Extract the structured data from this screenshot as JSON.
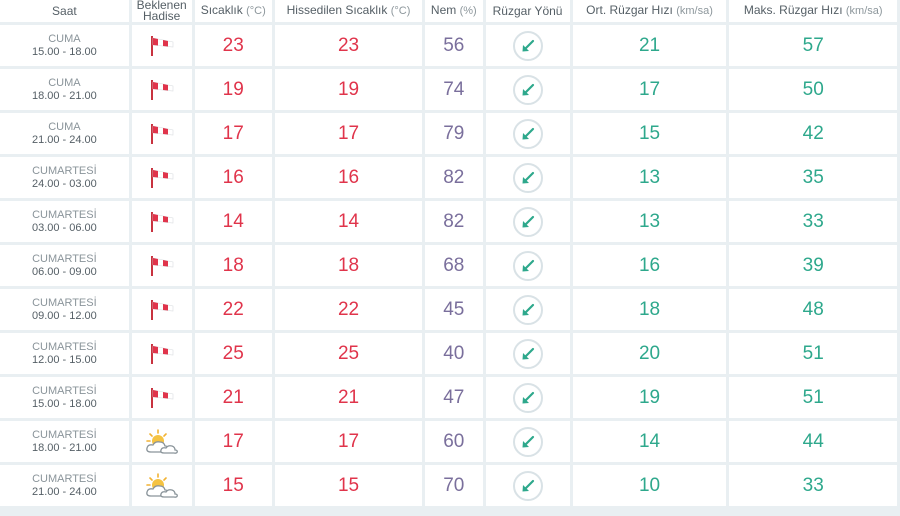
{
  "headers": {
    "saat": "Saat",
    "hadise_line1": "Beklenen",
    "hadise_line2": "Hadise",
    "sicaklik": "Sıcaklık",
    "sicaklik_unit": "(°C)",
    "hissedilen": "Hissedilen Sıcaklık",
    "hissedilen_unit": "(°C)",
    "nem": "Nem",
    "nem_unit": "(%)",
    "ruzgar_yonu": "Rüzgar Yönü",
    "ort_ruzgar": "Ort. Rüzgar Hızı",
    "ort_ruzgar_unit": "(km/sa)",
    "maks_ruzgar": "Maks. Rüzgar Hızı",
    "maks_ruzgar_unit": "(km/sa)"
  },
  "colors": {
    "temperature": "#e0344b",
    "humidity": "#7a6f9c",
    "wind": "#2ea88c",
    "background": "#e9eff2"
  },
  "rows": [
    {
      "day": "CUMA",
      "time": "15.00 - 18.00",
      "icon": "windy-flag-icon",
      "temp": "23",
      "feels": "23",
      "humidity": "56",
      "wind_dir_icon": "arrow-southwest-icon",
      "avg_wind": "21",
      "max_wind": "57"
    },
    {
      "day": "CUMA",
      "time": "18.00 - 21.00",
      "icon": "windy-flag-icon",
      "temp": "19",
      "feels": "19",
      "humidity": "74",
      "wind_dir_icon": "arrow-southwest-icon",
      "avg_wind": "17",
      "max_wind": "50"
    },
    {
      "day": "CUMA",
      "time": "21.00 - 24.00",
      "icon": "windy-flag-icon",
      "temp": "17",
      "feels": "17",
      "humidity": "79",
      "wind_dir_icon": "arrow-southwest-icon",
      "avg_wind": "15",
      "max_wind": "42"
    },
    {
      "day": "CUMARTESİ",
      "time": "24.00 - 03.00",
      "icon": "windy-flag-icon",
      "temp": "16",
      "feels": "16",
      "humidity": "82",
      "wind_dir_icon": "arrow-southwest-icon",
      "avg_wind": "13",
      "max_wind": "35"
    },
    {
      "day": "CUMARTESİ",
      "time": "03.00 - 06.00",
      "icon": "windy-flag-icon",
      "temp": "14",
      "feels": "14",
      "humidity": "82",
      "wind_dir_icon": "arrow-southwest-icon",
      "avg_wind": "13",
      "max_wind": "33"
    },
    {
      "day": "CUMARTESİ",
      "time": "06.00 - 09.00",
      "icon": "windy-flag-icon",
      "temp": "18",
      "feels": "18",
      "humidity": "68",
      "wind_dir_icon": "arrow-southwest-icon",
      "avg_wind": "16",
      "max_wind": "39"
    },
    {
      "day": "CUMARTESİ",
      "time": "09.00 - 12.00",
      "icon": "windy-flag-icon",
      "temp": "22",
      "feels": "22",
      "humidity": "45",
      "wind_dir_icon": "arrow-southwest-icon",
      "avg_wind": "18",
      "max_wind": "48"
    },
    {
      "day": "CUMARTESİ",
      "time": "12.00 - 15.00",
      "icon": "windy-flag-icon",
      "temp": "25",
      "feels": "25",
      "humidity": "40",
      "wind_dir_icon": "arrow-southwest-icon",
      "avg_wind": "20",
      "max_wind": "51"
    },
    {
      "day": "CUMARTESİ",
      "time": "15.00 - 18.00",
      "icon": "windy-flag-icon",
      "temp": "21",
      "feels": "21",
      "humidity": "47",
      "wind_dir_icon": "arrow-southwest-icon",
      "avg_wind": "19",
      "max_wind": "51"
    },
    {
      "day": "CUMARTESİ",
      "time": "18.00 - 21.00",
      "icon": "partly-cloudy-icon",
      "temp": "17",
      "feels": "17",
      "humidity": "60",
      "wind_dir_icon": "arrow-southwest-icon",
      "avg_wind": "14",
      "max_wind": "44"
    },
    {
      "day": "CUMARTESİ",
      "time": "21.00 - 24.00",
      "icon": "partly-cloudy-icon",
      "temp": "15",
      "feels": "15",
      "humidity": "70",
      "wind_dir_icon": "arrow-southwest-icon",
      "avg_wind": "10",
      "max_wind": "33"
    }
  ]
}
